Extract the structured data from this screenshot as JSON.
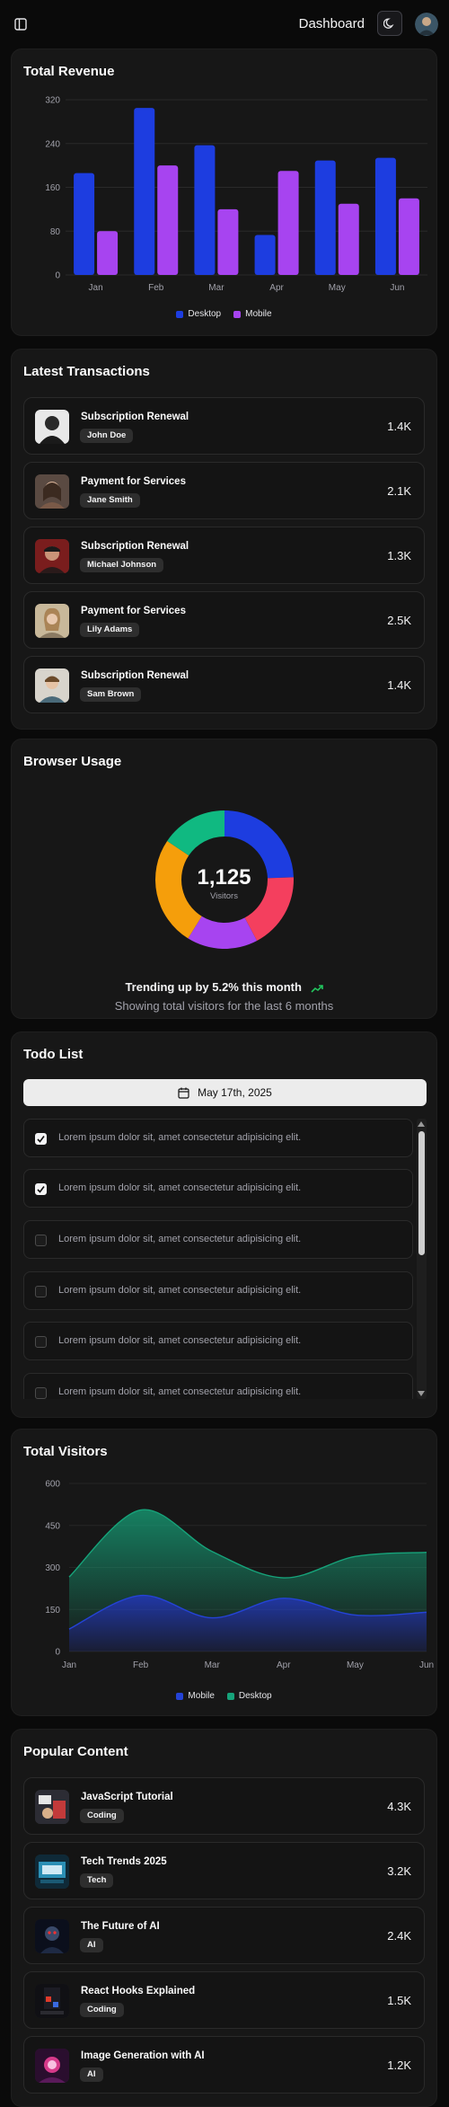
{
  "header": {
    "title": "Dashboard",
    "sidebar_toggle_icon": "panel-left-icon",
    "theme_toggle_icon": "moon-icon"
  },
  "colors": {
    "desktop": "#1d3de0",
    "mobile": "#a744f0",
    "visitors_desktop": "#16a37a",
    "visitors_mobile": "#2443d6",
    "trend_icon": "#22c55e"
  },
  "revenue": {
    "title": "Total Revenue",
    "legend": [
      "Desktop",
      "Mobile"
    ]
  },
  "transactions": {
    "title": "Latest Transactions",
    "items": [
      {
        "title": "Subscription Renewal",
        "name": "John Doe",
        "value": "1.4K"
      },
      {
        "title": "Payment for Services",
        "name": "Jane Smith",
        "value": "2.1K"
      },
      {
        "title": "Subscription Renewal",
        "name": "Michael Johnson",
        "value": "1.3K"
      },
      {
        "title": "Payment for Services",
        "name": "Lily Adams",
        "value": "2.5K"
      },
      {
        "title": "Subscription Renewal",
        "name": "Sam Brown",
        "value": "1.4K"
      }
    ]
  },
  "browser": {
    "title": "Browser Usage",
    "total": "1,125",
    "total_label": "Visitors",
    "trend_text": "Trending up by 5.2% this month",
    "sub_text": "Showing total visitors for the last 6 months"
  },
  "todo": {
    "title": "Todo List",
    "date": "May 17th, 2025",
    "items": [
      {
        "text": "Lorem ipsum dolor sit, amet consectetur adipisicing elit.",
        "checked": true
      },
      {
        "text": "Lorem ipsum dolor sit, amet consectetur adipisicing elit.",
        "checked": true
      },
      {
        "text": "Lorem ipsum dolor sit, amet consectetur adipisicing elit.",
        "checked": false
      },
      {
        "text": "Lorem ipsum dolor sit, amet consectetur adipisicing elit.",
        "checked": false
      },
      {
        "text": "Lorem ipsum dolor sit, amet consectetur adipisicing elit.",
        "checked": false
      },
      {
        "text": "Lorem ipsum dolor sit, amet consectetur adipisicing elit.",
        "checked": false
      }
    ]
  },
  "visitors": {
    "title": "Total Visitors",
    "legend": [
      "Mobile",
      "Desktop"
    ]
  },
  "popular": {
    "title": "Popular Content",
    "items": [
      {
        "title": "JavaScript Tutorial",
        "tag": "Coding",
        "value": "4.3K"
      },
      {
        "title": "Tech Trends 2025",
        "tag": "Tech",
        "value": "3.2K"
      },
      {
        "title": "The Future of AI",
        "tag": "AI",
        "value": "2.4K"
      },
      {
        "title": "React Hooks Explained",
        "tag": "Coding",
        "value": "1.5K"
      },
      {
        "title": "Image Generation with AI",
        "tag": "AI",
        "value": "1.2K"
      }
    ]
  },
  "chart_data": [
    {
      "type": "bar",
      "title": "Total Revenue",
      "categories": [
        "Jan",
        "Feb",
        "Mar",
        "Apr",
        "May",
        "Jun"
      ],
      "series": [
        {
          "name": "Desktop",
          "values": [
            186,
            305,
            237,
            73,
            209,
            214
          ]
        },
        {
          "name": "Mobile",
          "values": [
            80,
            200,
            120,
            190,
            130,
            140
          ]
        }
      ],
      "yticks": [
        0,
        80,
        160,
        240,
        320
      ],
      "ylim": [
        0,
        320
      ],
      "grid": true,
      "legend_position": "bottom"
    },
    {
      "type": "pie",
      "title": "Browser Usage",
      "donut": true,
      "slices": [
        {
          "value": 275,
          "color": "#1d3de0"
        },
        {
          "value": 200,
          "color": "#f43f5e"
        },
        {
          "value": 187,
          "color": "#a744f0"
        },
        {
          "value": 288,
          "color": "#f59e0b"
        },
        {
          "value": 175,
          "color": "#10b981"
        }
      ],
      "total": "1,125",
      "total_label": "Visitors"
    },
    {
      "type": "area",
      "title": "Total Visitors",
      "categories": [
        "Jan",
        "Feb",
        "Mar",
        "Apr",
        "May",
        "Jun"
      ],
      "stacked": true,
      "series": [
        {
          "name": "Mobile",
          "values": [
            80,
            200,
            120,
            190,
            130,
            140
          ]
        },
        {
          "name": "Desktop",
          "values": [
            186,
            305,
            237,
            73,
            209,
            214
          ]
        }
      ],
      "yticks": [
        0,
        150,
        300,
        450,
        600
      ],
      "ylim": [
        0,
        600
      ],
      "grid": true,
      "legend_position": "bottom"
    }
  ]
}
